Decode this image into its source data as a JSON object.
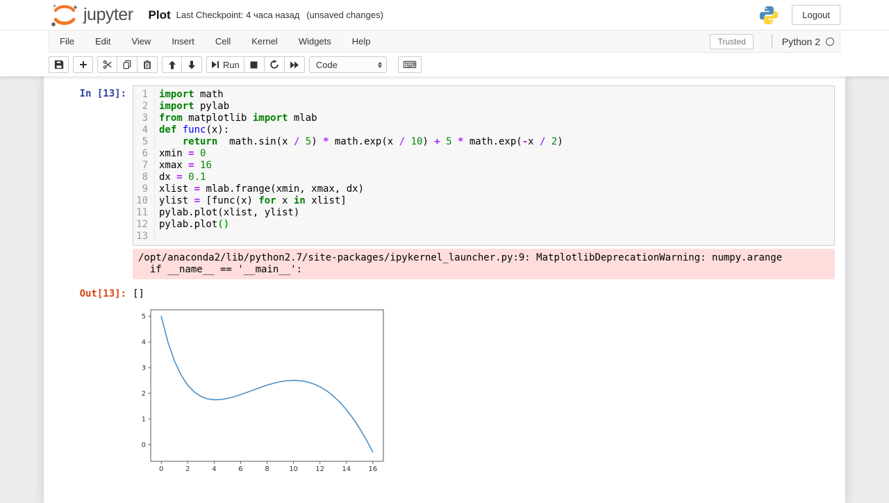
{
  "header": {
    "logo_text": "jupyter",
    "title": "Plot",
    "checkpoint": "Last Checkpoint: 4 часа назад",
    "unsaved": "(unsaved changes)",
    "logout_label": "Logout"
  },
  "menubar": {
    "items": [
      "File",
      "Edit",
      "View",
      "Insert",
      "Cell",
      "Kernel",
      "Widgets",
      "Help"
    ],
    "trusted_label": "Trusted",
    "kernel_name": "Python 2"
  },
  "toolbar": {
    "run_label": "Run",
    "cell_type": "Code"
  },
  "cell": {
    "input_prompt": "In [13]:",
    "code_lines": [
      {
        "n": "1",
        "tokens": [
          [
            "import",
            "kw"
          ],
          [
            " math",
            ""
          ]
        ]
      },
      {
        "n": "2",
        "tokens": [
          [
            "import",
            "kw"
          ],
          [
            " pylab",
            ""
          ]
        ]
      },
      {
        "n": "3",
        "tokens": [
          [
            "from",
            "kw"
          ],
          [
            " matplotlib ",
            ""
          ],
          [
            "import",
            "kw"
          ],
          [
            " mlab",
            ""
          ]
        ]
      },
      {
        "n": "4",
        "tokens": [
          [
            "def",
            "kw"
          ],
          [
            " ",
            ""
          ],
          [
            "func",
            "def"
          ],
          [
            "(x):",
            ""
          ]
        ]
      },
      {
        "n": "5",
        "tokens": [
          [
            "    ",
            ""
          ],
          [
            "return",
            "kw"
          ],
          [
            "  math.sin(x ",
            ""
          ],
          [
            "/",
            "op"
          ],
          [
            " ",
            ""
          ],
          [
            "5",
            "num"
          ],
          [
            ") ",
            ""
          ],
          [
            "*",
            "op"
          ],
          [
            " math.exp(x ",
            ""
          ],
          [
            "/",
            "op"
          ],
          [
            " ",
            ""
          ],
          [
            "10",
            "num"
          ],
          [
            ") ",
            ""
          ],
          [
            "+",
            "op"
          ],
          [
            " ",
            ""
          ],
          [
            "5",
            "num"
          ],
          [
            " ",
            ""
          ],
          [
            "*",
            "op"
          ],
          [
            " math.exp(",
            ""
          ],
          [
            "-",
            "op"
          ],
          [
            "x ",
            ""
          ],
          [
            "/",
            "op"
          ],
          [
            " ",
            ""
          ],
          [
            "2",
            "num"
          ],
          [
            ")",
            ""
          ]
        ]
      },
      {
        "n": "6",
        "tokens": [
          [
            "xmin ",
            ""
          ],
          [
            "=",
            "op"
          ],
          [
            " ",
            ""
          ],
          [
            "0",
            "num"
          ]
        ]
      },
      {
        "n": "7",
        "tokens": [
          [
            "xmax ",
            ""
          ],
          [
            "=",
            "op"
          ],
          [
            " ",
            ""
          ],
          [
            "16",
            "num"
          ]
        ]
      },
      {
        "n": "8",
        "tokens": [
          [
            "dx ",
            ""
          ],
          [
            "=",
            "op"
          ],
          [
            " ",
            ""
          ],
          [
            "0.1",
            "num"
          ]
        ]
      },
      {
        "n": "9",
        "tokens": [
          [
            "xlist ",
            ""
          ],
          [
            "=",
            "op"
          ],
          [
            " mlab.frange(xmin, xmax, dx)",
            ""
          ]
        ]
      },
      {
        "n": "10",
        "tokens": [
          [
            "ylist ",
            ""
          ],
          [
            "=",
            "op"
          ],
          [
            " [func(x) ",
            ""
          ],
          [
            "for",
            "kw"
          ],
          [
            " x ",
            ""
          ],
          [
            "in",
            "kw"
          ],
          [
            " xlist]",
            ""
          ]
        ]
      },
      {
        "n": "11",
        "tokens": [
          [
            "pylab.plot(xlist, ylist)",
            ""
          ]
        ]
      },
      {
        "n": "12",
        "tokens": [
          [
            "pylab.plot",
            ""
          ],
          [
            "()",
            "bracket"
          ]
        ]
      },
      {
        "n": "13",
        "tokens": []
      }
    ],
    "stderr_lines": [
      "/opt/anaconda2/lib/python2.7/site-packages/ipykernel_launcher.py:9: MatplotlibDeprecationWarning: numpy.arange",
      "  if __name__ == '__main__':"
    ],
    "output_prompt": "Out[13]:",
    "output_value": "[]"
  },
  "colors": {
    "jupyter_orange": "#f37726",
    "input_prompt": "#303f9f",
    "output_prompt": "#d84315",
    "stderr_bg": "#fdd9d9",
    "keyword_green": "#008000",
    "operator_purple": "#aa22ff"
  },
  "chart_data": {
    "type": "line",
    "title": "",
    "xlabel": "",
    "ylabel": "",
    "xlim": [
      -0.8,
      16.8
    ],
    "ylim": [
      -0.65,
      5.25
    ],
    "xticks": [
      0,
      2,
      4,
      6,
      8,
      10,
      12,
      14,
      16
    ],
    "yticks": [
      0,
      1,
      2,
      3,
      4,
      5
    ],
    "grid": false,
    "legend": "none",
    "line_color": "#4a90c9",
    "series": [
      {
        "name": "ylist = func(xlist)  where func(x)=sin(x/5)*exp(x/10)+5*exp(-x/2)",
        "x": [
          0,
          0.5,
          1,
          1.5,
          2,
          2.5,
          3,
          3.5,
          4,
          4.5,
          5,
          5.5,
          6,
          6.5,
          7,
          7.5,
          8,
          8.5,
          9,
          9.5,
          10,
          10.5,
          11,
          11.5,
          12,
          12.5,
          13,
          13.5,
          14,
          14.5,
          15,
          15.5,
          16
        ],
        "y": [
          5.0,
          3.999,
          3.252,
          2.705,
          2.315,
          2.048,
          1.878,
          1.783,
          1.747,
          1.755,
          1.798,
          1.864,
          1.947,
          2.04,
          2.135,
          2.229,
          2.316,
          2.391,
          2.451,
          2.49,
          2.505,
          2.493,
          2.449,
          2.371,
          2.255,
          2.099,
          1.899,
          1.655,
          1.363,
          1.023,
          0.635,
          0.198,
          -0.287
        ]
      }
    ]
  }
}
